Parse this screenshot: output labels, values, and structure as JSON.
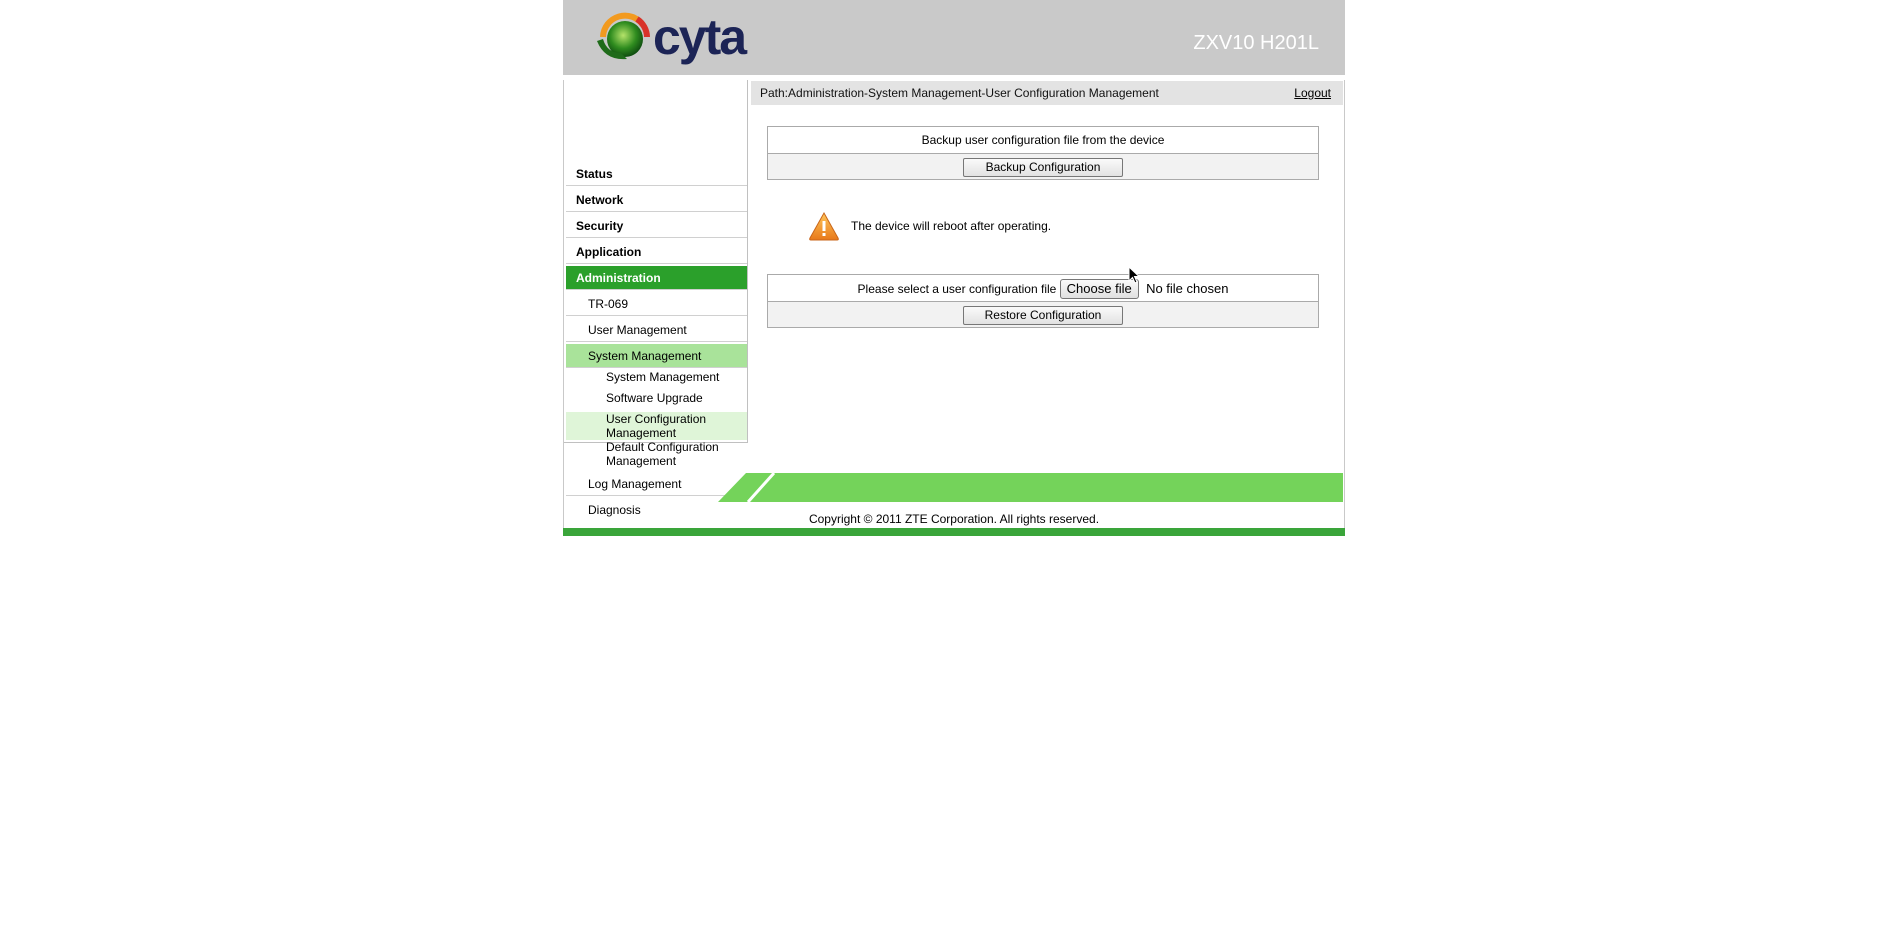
{
  "header": {
    "brand": "cyta",
    "model": "ZXV10 H201L"
  },
  "sidebar": {
    "items": [
      {
        "label": "Status"
      },
      {
        "label": "Network"
      },
      {
        "label": "Security"
      },
      {
        "label": "Application"
      },
      {
        "label": "Administration"
      },
      {
        "label": "TR-069"
      },
      {
        "label": "User Management"
      },
      {
        "label": "System Management"
      },
      {
        "label": "System Management"
      },
      {
        "label": "Software Upgrade"
      },
      {
        "label": "User Configuration Management"
      },
      {
        "label": "Default Configuration Management"
      },
      {
        "label": "Log Management"
      },
      {
        "label": "Diagnosis"
      }
    ]
  },
  "pathbar": {
    "path": "Path:Administration-System Management-User Configuration Management",
    "logout": "Logout"
  },
  "backup": {
    "title": "Backup user configuration file from the device",
    "button": "Backup Configuration"
  },
  "warning": {
    "text": "The device will reboot after operating.",
    "icon": "warning-icon"
  },
  "restore": {
    "label": "Please select a user configuration file",
    "choose_button": "Choose file",
    "file_status": "No file chosen",
    "button": "Restore Configuration"
  },
  "footer": {
    "copyright": "Copyright © 2011 ZTE Corporation. All rights reserved."
  },
  "colors": {
    "header_bg": "#c9c9c9",
    "active_green": "#2ba02b",
    "light_green": "#a9e39a",
    "footer_green": "#74d35a"
  }
}
